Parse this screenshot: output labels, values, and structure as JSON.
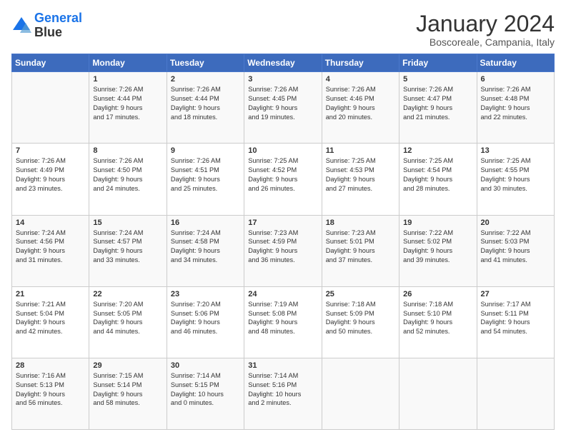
{
  "header": {
    "logo_line1": "General",
    "logo_line2": "Blue",
    "main_title": "January 2024",
    "subtitle": "Boscoreale, Campania, Italy"
  },
  "days_of_week": [
    "Sunday",
    "Monday",
    "Tuesday",
    "Wednesday",
    "Thursday",
    "Friday",
    "Saturday"
  ],
  "weeks": [
    [
      {
        "num": "",
        "info": ""
      },
      {
        "num": "1",
        "info": "Sunrise: 7:26 AM\nSunset: 4:44 PM\nDaylight: 9 hours\nand 17 minutes."
      },
      {
        "num": "2",
        "info": "Sunrise: 7:26 AM\nSunset: 4:44 PM\nDaylight: 9 hours\nand 18 minutes."
      },
      {
        "num": "3",
        "info": "Sunrise: 7:26 AM\nSunset: 4:45 PM\nDaylight: 9 hours\nand 19 minutes."
      },
      {
        "num": "4",
        "info": "Sunrise: 7:26 AM\nSunset: 4:46 PM\nDaylight: 9 hours\nand 20 minutes."
      },
      {
        "num": "5",
        "info": "Sunrise: 7:26 AM\nSunset: 4:47 PM\nDaylight: 9 hours\nand 21 minutes."
      },
      {
        "num": "6",
        "info": "Sunrise: 7:26 AM\nSunset: 4:48 PM\nDaylight: 9 hours\nand 22 minutes."
      }
    ],
    [
      {
        "num": "7",
        "info": "Sunrise: 7:26 AM\nSunset: 4:49 PM\nDaylight: 9 hours\nand 23 minutes."
      },
      {
        "num": "8",
        "info": "Sunrise: 7:26 AM\nSunset: 4:50 PM\nDaylight: 9 hours\nand 24 minutes."
      },
      {
        "num": "9",
        "info": "Sunrise: 7:26 AM\nSunset: 4:51 PM\nDaylight: 9 hours\nand 25 minutes."
      },
      {
        "num": "10",
        "info": "Sunrise: 7:25 AM\nSunset: 4:52 PM\nDaylight: 9 hours\nand 26 minutes."
      },
      {
        "num": "11",
        "info": "Sunrise: 7:25 AM\nSunset: 4:53 PM\nDaylight: 9 hours\nand 27 minutes."
      },
      {
        "num": "12",
        "info": "Sunrise: 7:25 AM\nSunset: 4:54 PM\nDaylight: 9 hours\nand 28 minutes."
      },
      {
        "num": "13",
        "info": "Sunrise: 7:25 AM\nSunset: 4:55 PM\nDaylight: 9 hours\nand 30 minutes."
      }
    ],
    [
      {
        "num": "14",
        "info": "Sunrise: 7:24 AM\nSunset: 4:56 PM\nDaylight: 9 hours\nand 31 minutes."
      },
      {
        "num": "15",
        "info": "Sunrise: 7:24 AM\nSunset: 4:57 PM\nDaylight: 9 hours\nand 33 minutes."
      },
      {
        "num": "16",
        "info": "Sunrise: 7:24 AM\nSunset: 4:58 PM\nDaylight: 9 hours\nand 34 minutes."
      },
      {
        "num": "17",
        "info": "Sunrise: 7:23 AM\nSunset: 4:59 PM\nDaylight: 9 hours\nand 36 minutes."
      },
      {
        "num": "18",
        "info": "Sunrise: 7:23 AM\nSunset: 5:01 PM\nDaylight: 9 hours\nand 37 minutes."
      },
      {
        "num": "19",
        "info": "Sunrise: 7:22 AM\nSunset: 5:02 PM\nDaylight: 9 hours\nand 39 minutes."
      },
      {
        "num": "20",
        "info": "Sunrise: 7:22 AM\nSunset: 5:03 PM\nDaylight: 9 hours\nand 41 minutes."
      }
    ],
    [
      {
        "num": "21",
        "info": "Sunrise: 7:21 AM\nSunset: 5:04 PM\nDaylight: 9 hours\nand 42 minutes."
      },
      {
        "num": "22",
        "info": "Sunrise: 7:20 AM\nSunset: 5:05 PM\nDaylight: 9 hours\nand 44 minutes."
      },
      {
        "num": "23",
        "info": "Sunrise: 7:20 AM\nSunset: 5:06 PM\nDaylight: 9 hours\nand 46 minutes."
      },
      {
        "num": "24",
        "info": "Sunrise: 7:19 AM\nSunset: 5:08 PM\nDaylight: 9 hours\nand 48 minutes."
      },
      {
        "num": "25",
        "info": "Sunrise: 7:18 AM\nSunset: 5:09 PM\nDaylight: 9 hours\nand 50 minutes."
      },
      {
        "num": "26",
        "info": "Sunrise: 7:18 AM\nSunset: 5:10 PM\nDaylight: 9 hours\nand 52 minutes."
      },
      {
        "num": "27",
        "info": "Sunrise: 7:17 AM\nSunset: 5:11 PM\nDaylight: 9 hours\nand 54 minutes."
      }
    ],
    [
      {
        "num": "28",
        "info": "Sunrise: 7:16 AM\nSunset: 5:13 PM\nDaylight: 9 hours\nand 56 minutes."
      },
      {
        "num": "29",
        "info": "Sunrise: 7:15 AM\nSunset: 5:14 PM\nDaylight: 9 hours\nand 58 minutes."
      },
      {
        "num": "30",
        "info": "Sunrise: 7:14 AM\nSunset: 5:15 PM\nDaylight: 10 hours\nand 0 minutes."
      },
      {
        "num": "31",
        "info": "Sunrise: 7:14 AM\nSunset: 5:16 PM\nDaylight: 10 hours\nand 2 minutes."
      },
      {
        "num": "",
        "info": ""
      },
      {
        "num": "",
        "info": ""
      },
      {
        "num": "",
        "info": ""
      }
    ]
  ]
}
